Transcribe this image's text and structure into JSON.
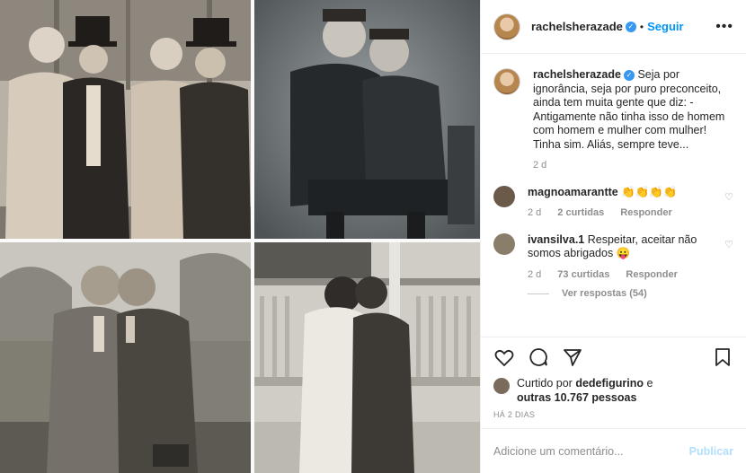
{
  "header": {
    "username": "rachelsherazade",
    "follow_label": "Seguir",
    "more_icon": "more-options-icon"
  },
  "caption": {
    "username": "rachelsherazade",
    "text_1": "Seja por ignorância, seja por puro preconceito, ainda tem muita gente que diz: - Antigamente não tinha isso de homem com homem e mulher com mulher!",
    "text_2": "Tinha sim. Aliás, sempre teve...",
    "age": "2 d"
  },
  "comments": [
    {
      "username": "magnoamarantte",
      "text": "👏👏👏👏",
      "age": "2 d",
      "likes": "2 curtidas",
      "reply": "Responder"
    },
    {
      "username": "ivansilva.1",
      "text": "Respeitar, aceitar não somos abrigados 😛",
      "age": "2 d",
      "likes": "73 curtidas",
      "reply": "Responder",
      "view_replies": "Ver respostas (54)"
    }
  ],
  "likes": {
    "prefix": "Curtido por",
    "user": "dedefigurino",
    "middle": "e",
    "count": "outras 10.767 pessoas"
  },
  "date": "HÁ 2 DIAS",
  "add_comment": {
    "placeholder": "Adicione um comentário...",
    "publish": "Publicar"
  },
  "colors": {
    "accent": "#0095f6",
    "verified": "#3897f0",
    "muted": "#8e8e8e"
  }
}
